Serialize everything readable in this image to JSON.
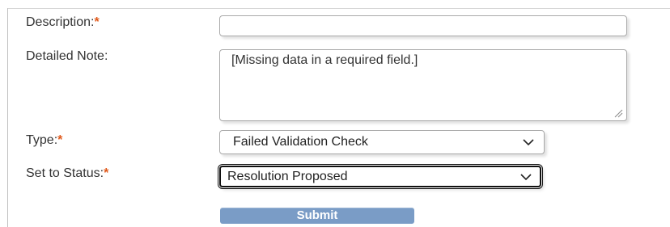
{
  "form": {
    "description": {
      "label": "Description:",
      "required_mark": "*",
      "value": ""
    },
    "detailed_note": {
      "label": "Detailed Note:",
      "value": "[Missing data in a required field.]"
    },
    "type": {
      "label": "Type:",
      "required_mark": "*",
      "selected": "Failed Validation Check"
    },
    "status": {
      "label": "Set to Status:",
      "required_mark": "*",
      "selected": "Resolution Proposed"
    },
    "submit_label": "Submit"
  },
  "colors": {
    "required_mark": "#e05a1c",
    "submit_bg": "#7a9cc6"
  },
  "icons": {
    "dropdown": "chevron-down-icon",
    "resize": "resize-grip-icon"
  }
}
